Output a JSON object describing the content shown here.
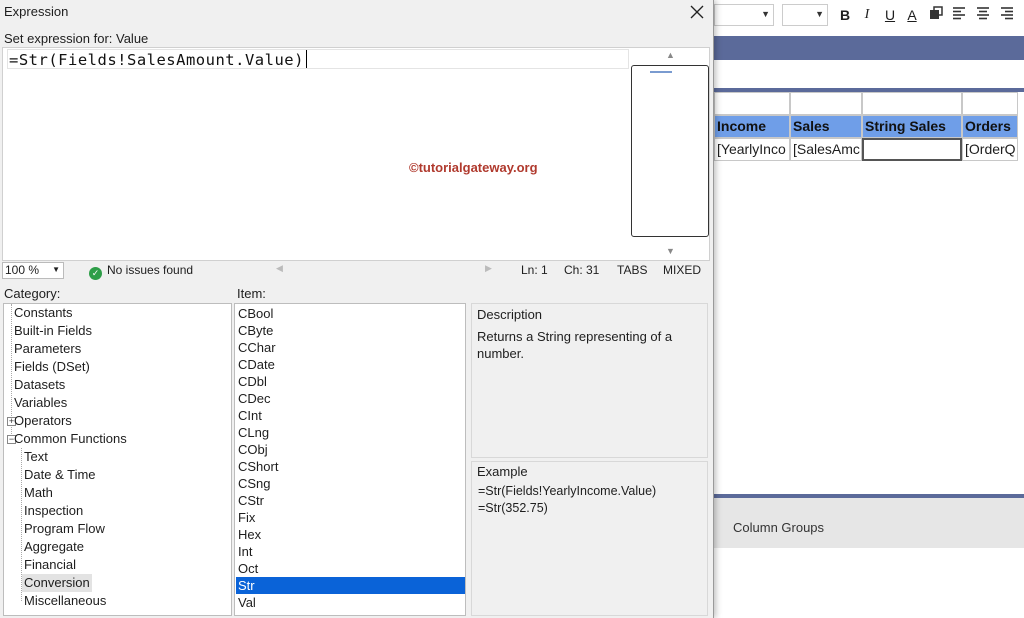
{
  "designer": {
    "toolbar": {
      "bold": "B",
      "italic": "I",
      "underline": "U",
      "font_color": "A"
    },
    "tablix": {
      "headers": [
        "Income",
        "Sales",
        "String Sales",
        "Orders"
      ],
      "cells": [
        "[YearlyInco",
        "[SalesAmc",
        "",
        "[OrderQ"
      ]
    },
    "column_groups": "Column Groups",
    "colors": {
      "band": "#5b6a9a",
      "header": "#6f9ee8"
    }
  },
  "dialog": {
    "title": "Expression",
    "set_label": "Set expression for: Value",
    "expression": "=Str(Fields!SalesAmount.Value)",
    "watermark": "©tutorialgateway.org",
    "status": {
      "zoom": "100 %",
      "issues": "No issues found",
      "line": "Ln: 1",
      "char": "Ch: 31",
      "tabs": "TABS",
      "mode": "MIXED"
    },
    "category_label": "Category:",
    "item_label": "Item:",
    "categories": [
      "Constants",
      "Built-in Fields",
      "Parameters",
      "Fields (DSet)",
      "Datasets",
      "Variables",
      "Operators",
      "Common Functions"
    ],
    "common_functions": [
      "Text",
      "Date & Time",
      "Math",
      "Inspection",
      "Program Flow",
      "Aggregate",
      "Financial",
      "Conversion",
      "Miscellaneous"
    ],
    "selected_category": "Conversion",
    "items": [
      "CBool",
      "CByte",
      "CChar",
      "CDate",
      "CDbl",
      "CDec",
      "CInt",
      "CLng",
      "CObj",
      "CShort",
      "CSng",
      "CStr",
      "Fix",
      "Hex",
      "Int",
      "Oct",
      "Str",
      "Val"
    ],
    "selected_item": "Str",
    "description": {
      "title": "Description",
      "text": "Returns a String representing of a number."
    },
    "example": {
      "title": "Example",
      "lines": [
        "=Str(Fields!YearlyIncome.Value)",
        "=Str(352.75)"
      ]
    },
    "colors": {
      "selection": "#0a63d8",
      "ok": "#2e9e48",
      "watermark": "#b03a2e"
    }
  }
}
